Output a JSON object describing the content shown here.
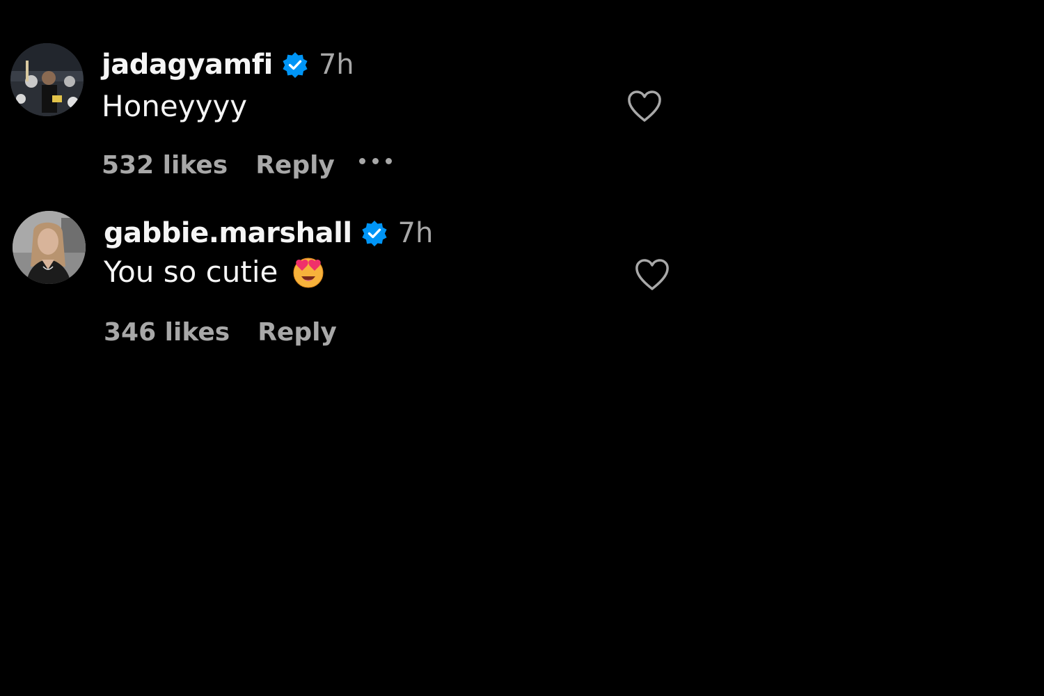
{
  "comments": [
    {
      "username": "jadagyamfi",
      "verified": true,
      "time": "7h",
      "text": "Honeyyyy",
      "emoji": "",
      "likes": "532 likes",
      "reply_label": "Reply",
      "has_more_menu": true
    },
    {
      "username": "gabbie.marshall",
      "verified": true,
      "time": "7h",
      "text": "You so cutie",
      "emoji": "smiling-face-with-heart-eyes",
      "likes": "346 likes",
      "reply_label": "Reply",
      "has_more_menu": false
    }
  ],
  "colors": {
    "background": "#000000",
    "primary_text": "#f5f5f5",
    "secondary_text": "#a8a8a8",
    "verified_badge": "#0095f6"
  }
}
